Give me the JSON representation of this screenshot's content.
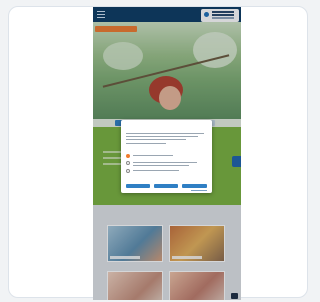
{
  "page": {
    "section_title": "",
    "modal_title": ""
  },
  "colors": {
    "navy": "#0b3b63",
    "accent_orange": "#f07c2f",
    "brand_green": "#7bb33f",
    "link_blue": "#2f7fc4"
  },
  "icons": {
    "menu": "menu-icon",
    "scroll_top": "arrow-up-icon",
    "side_tab": "side-tab-icon"
  }
}
